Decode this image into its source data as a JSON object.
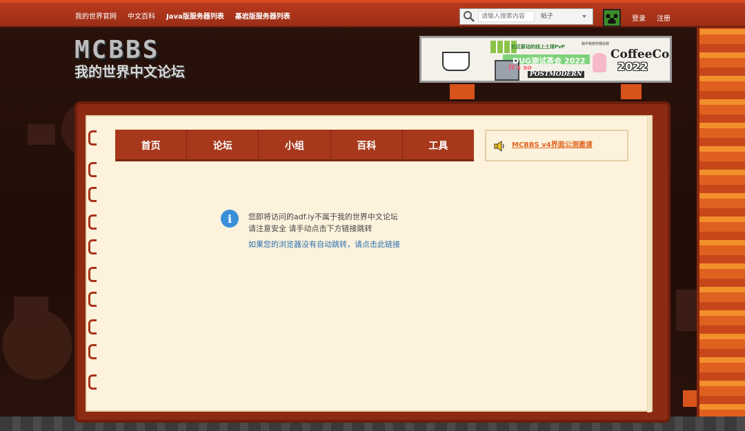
{
  "topbar": {
    "links": [
      {
        "label": "我的世界官网"
      },
      {
        "label": "中文百科"
      },
      {
        "label": "Java版服务器列表"
      },
      {
        "label": "基岩版服务器列表"
      }
    ],
    "search": {
      "placeholder": "请输入搜索内容",
      "scope": "帖子"
    },
    "login": "登录",
    "register": "注册"
  },
  "logo": {
    "title": "MCBBS",
    "subtitle": "我的世界中文论坛"
  },
  "banner": {
    "line1": "社区薪动的线上土球PvP",
    "line2": "我中我想你相信我",
    "line3": "DUG测试茶会 2022",
    "line4": "It's so",
    "line5": "POSTMODERN",
    "line6": "CoffeeCon",
    "line7": "2022"
  },
  "nav": {
    "items": [
      {
        "label": "首页"
      },
      {
        "label": "论坛"
      },
      {
        "label": "小组"
      },
      {
        "label": "百科"
      },
      {
        "label": "工具"
      }
    ]
  },
  "notice": {
    "text": "MCBBS v4界面公测邀请"
  },
  "message": {
    "line1": "您即将访问的adf.ly不属于我的世界中文论坛",
    "line2": "请注意安全 请手动点击下方链接跳转",
    "link": "如果您的浏览器没有自动跳转，请点击此链接"
  },
  "colors": {
    "topbar": "#b8391c",
    "nav": "#a7381c",
    "paper": "#fdf2dc",
    "notice_text": "#e0641f",
    "link": "#2a6fb0",
    "info_icon": "#3a8fd9"
  }
}
